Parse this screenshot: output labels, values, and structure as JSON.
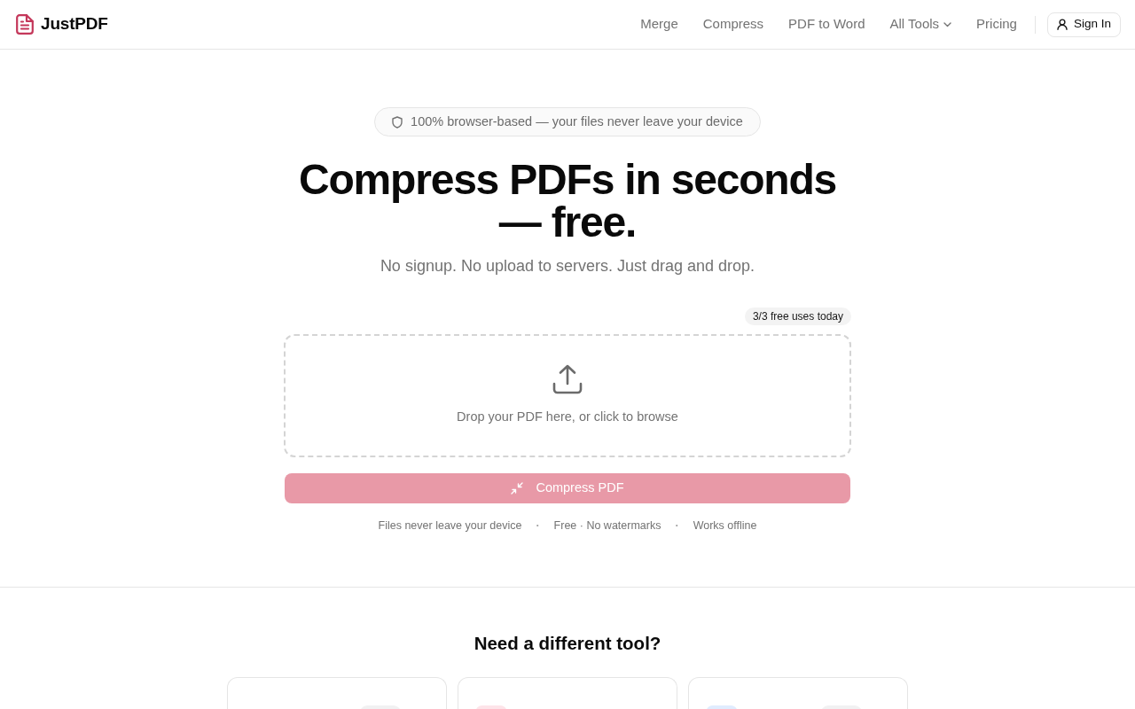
{
  "header": {
    "logo": "JustPDF",
    "nav": [
      {
        "label": "Merge",
        "kind": "link"
      },
      {
        "label": "Compress",
        "kind": "link"
      },
      {
        "label": "PDF to Word",
        "kind": "link"
      },
      {
        "label": "All Tools",
        "kind": "dropdown"
      },
      {
        "label": "Pricing",
        "kind": "link"
      }
    ],
    "sign_in": "Sign In"
  },
  "hero": {
    "notice": "100% browser-based — your files never leave your device",
    "title": "Compress PDFs in seconds — free.",
    "subtitle": "No signup. No upload to servers. Just drag and drop.",
    "usage_badge": "3/3 free uses today",
    "dropzone": {
      "text": "Drop your PDF here, or click to browse"
    },
    "action": {
      "label": "Compress PDF",
      "disabled": true
    },
    "features": [
      {
        "kind": "text",
        "text": "Files never leave your device"
      },
      {
        "kind": "separator",
        "text": "·"
      },
      {
        "kind": "text",
        "text": "Free · No watermarks"
      },
      {
        "kind": "separator",
        "text": "·"
      },
      {
        "kind": "text",
        "text": "Works offline"
      }
    ]
  },
  "more_tools": {
    "title": "Need a different tool?",
    "cards": [
      {
        "tile": false,
        "pill": true
      },
      {
        "tile": true,
        "color": "#fde4e9",
        "pill": false
      },
      {
        "tile": true,
        "color": "#e0ecfe",
        "pill": true
      }
    ]
  }
}
